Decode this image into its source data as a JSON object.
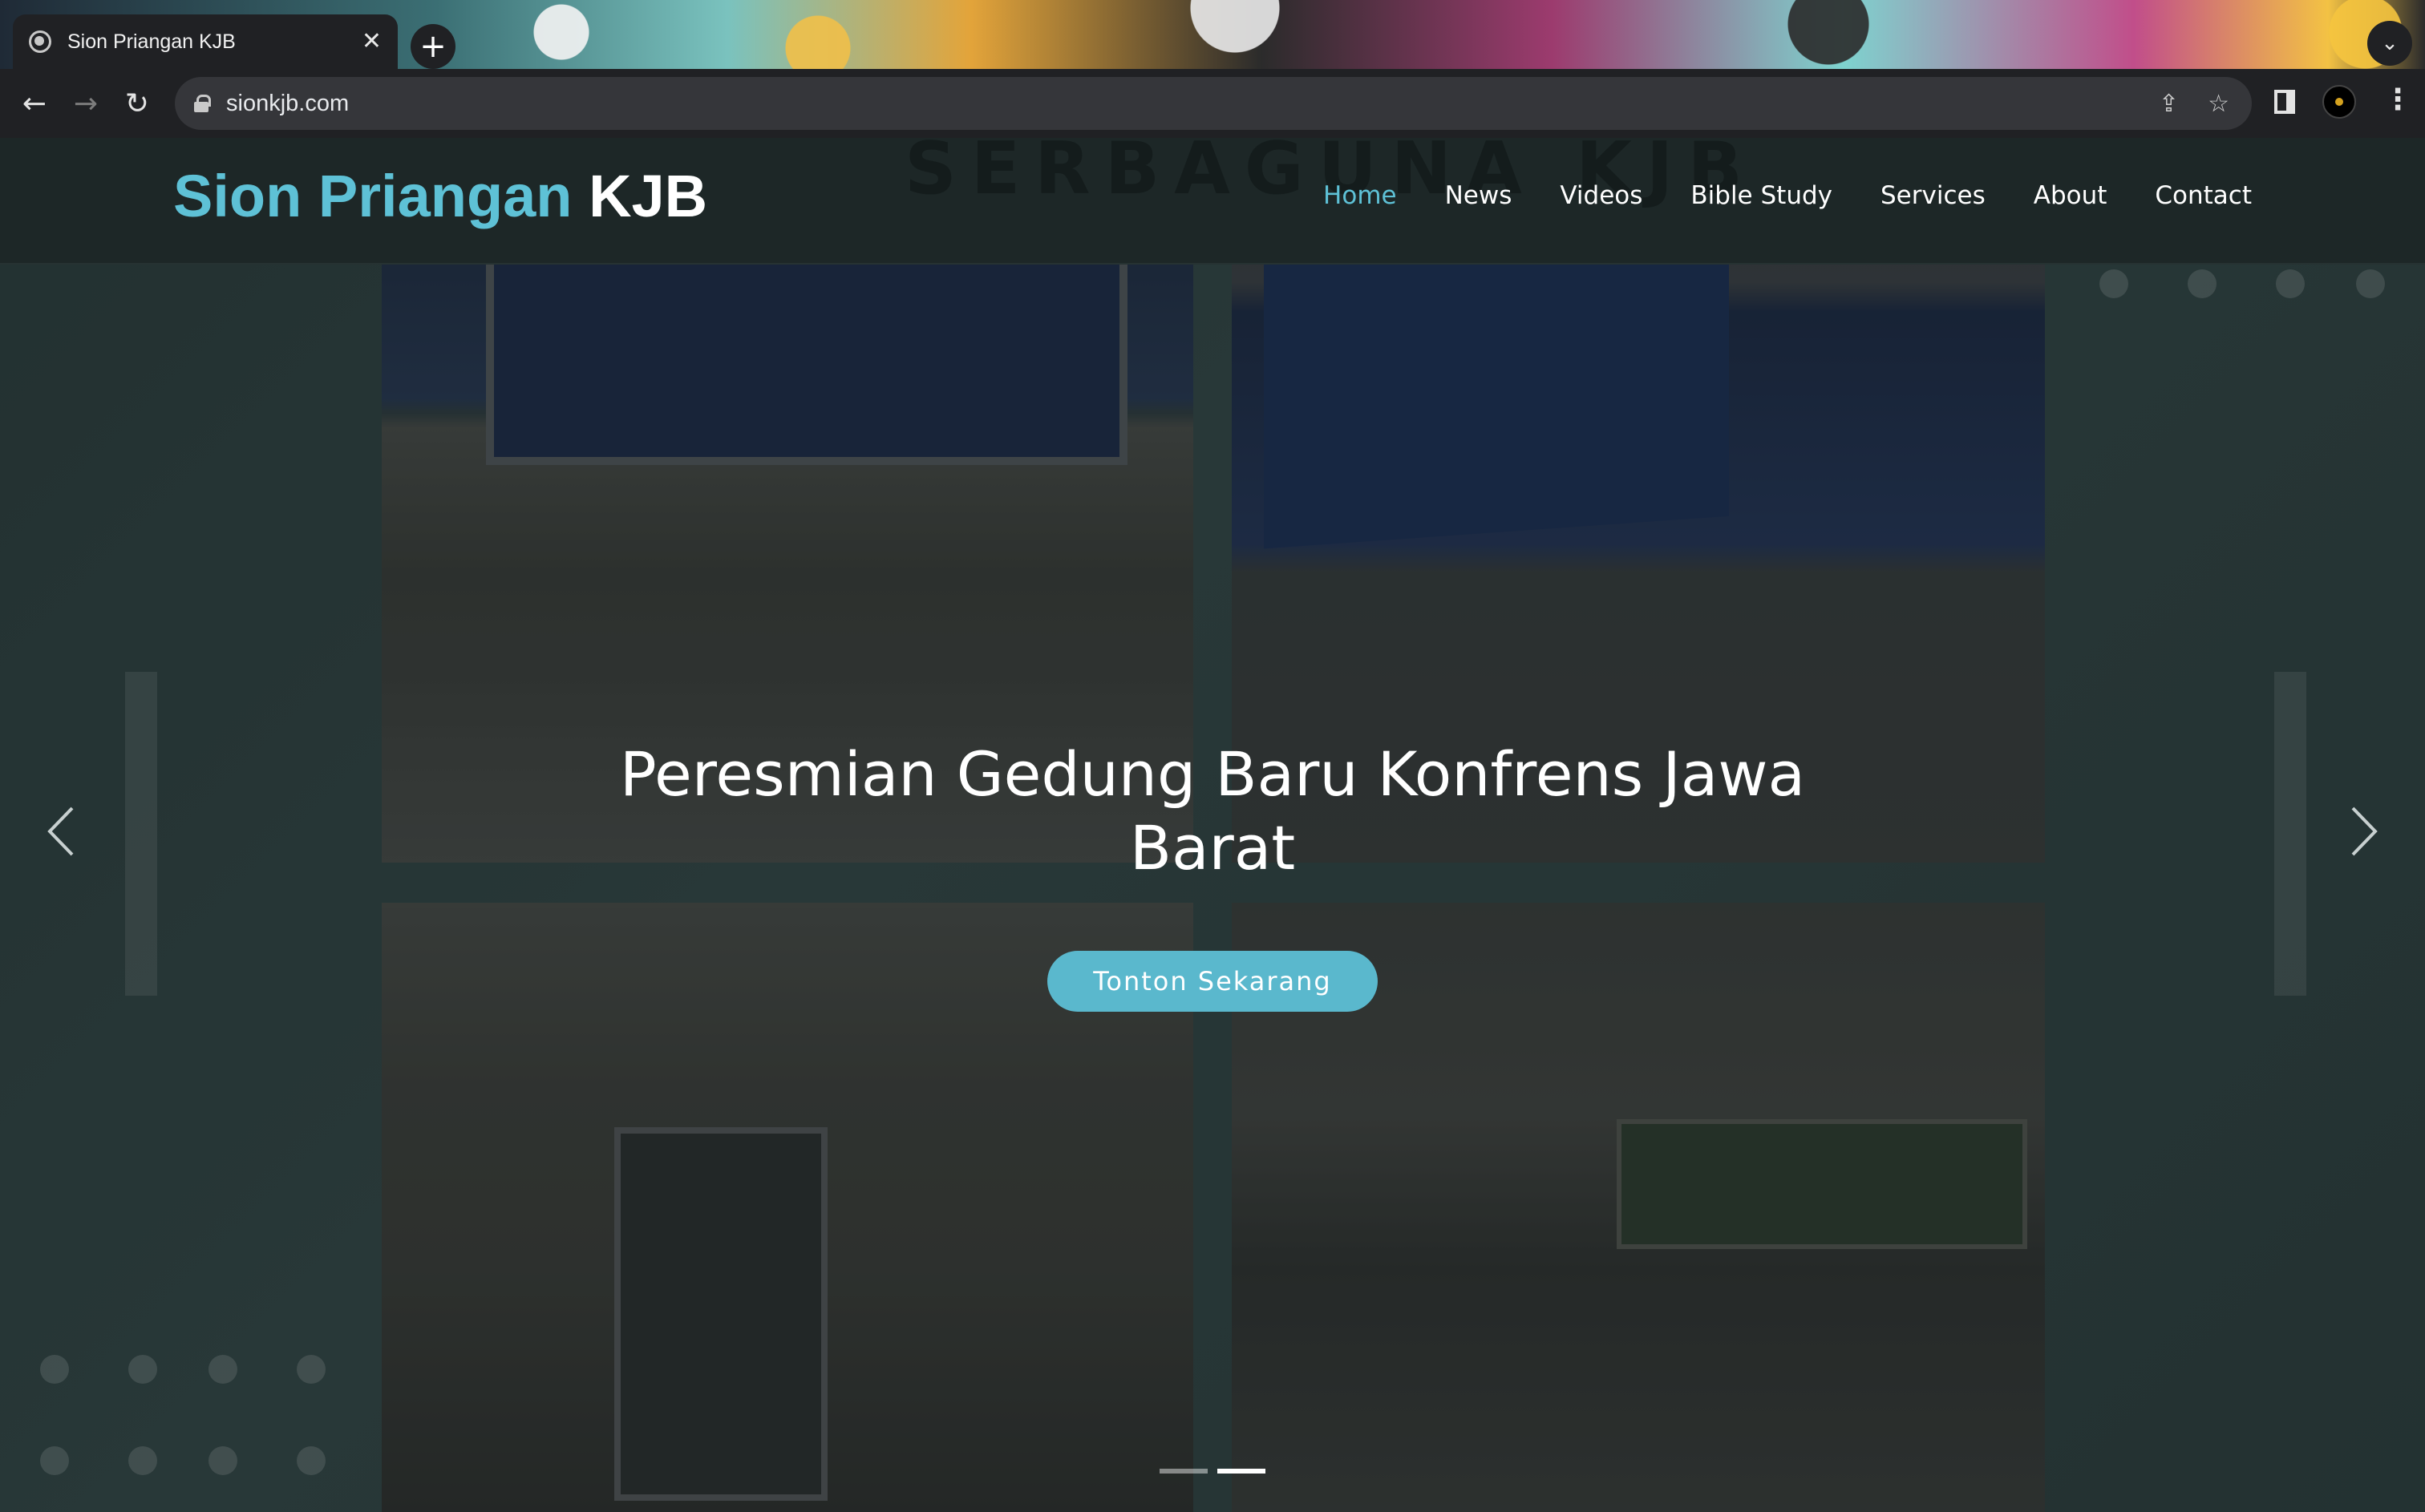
{
  "browser": {
    "tab_title": "Sion Priangan KJB",
    "tab_close": "✕",
    "new_tab": "+",
    "tab_menu": "⌄",
    "url": "sionkjb.com",
    "back": "←",
    "forward": "→",
    "reload": "↻",
    "share": "⇪",
    "bookmark": "☆",
    "menu": "⋮"
  },
  "site": {
    "brand_primary": "Sion Priangan",
    "brand_secondary": "KJB",
    "header_background_text": "SERBAGUNA KJB",
    "nav": {
      "home": "Home",
      "news": "News",
      "videos": "Videos",
      "bible_study": "Bible Study",
      "services": "Services",
      "about": "About",
      "contact": "Contact"
    },
    "active_nav": "Home",
    "hero": {
      "caption": "Peresmian Gedung Baru Konfrens Jawa Barat",
      "button_label": "Tonton Sekarang",
      "slide_count": 2,
      "active_slide": 2
    }
  },
  "colors": {
    "accent": "#5ec1d6",
    "button": "#5ab8cd",
    "header_bg": "#1d2727",
    "page_bg": "#2f3f3f"
  },
  "icons": {
    "prev": "chevron-left-icon",
    "next": "chevron-right-icon",
    "lock": "lock-icon",
    "globe": "globe-icon"
  }
}
